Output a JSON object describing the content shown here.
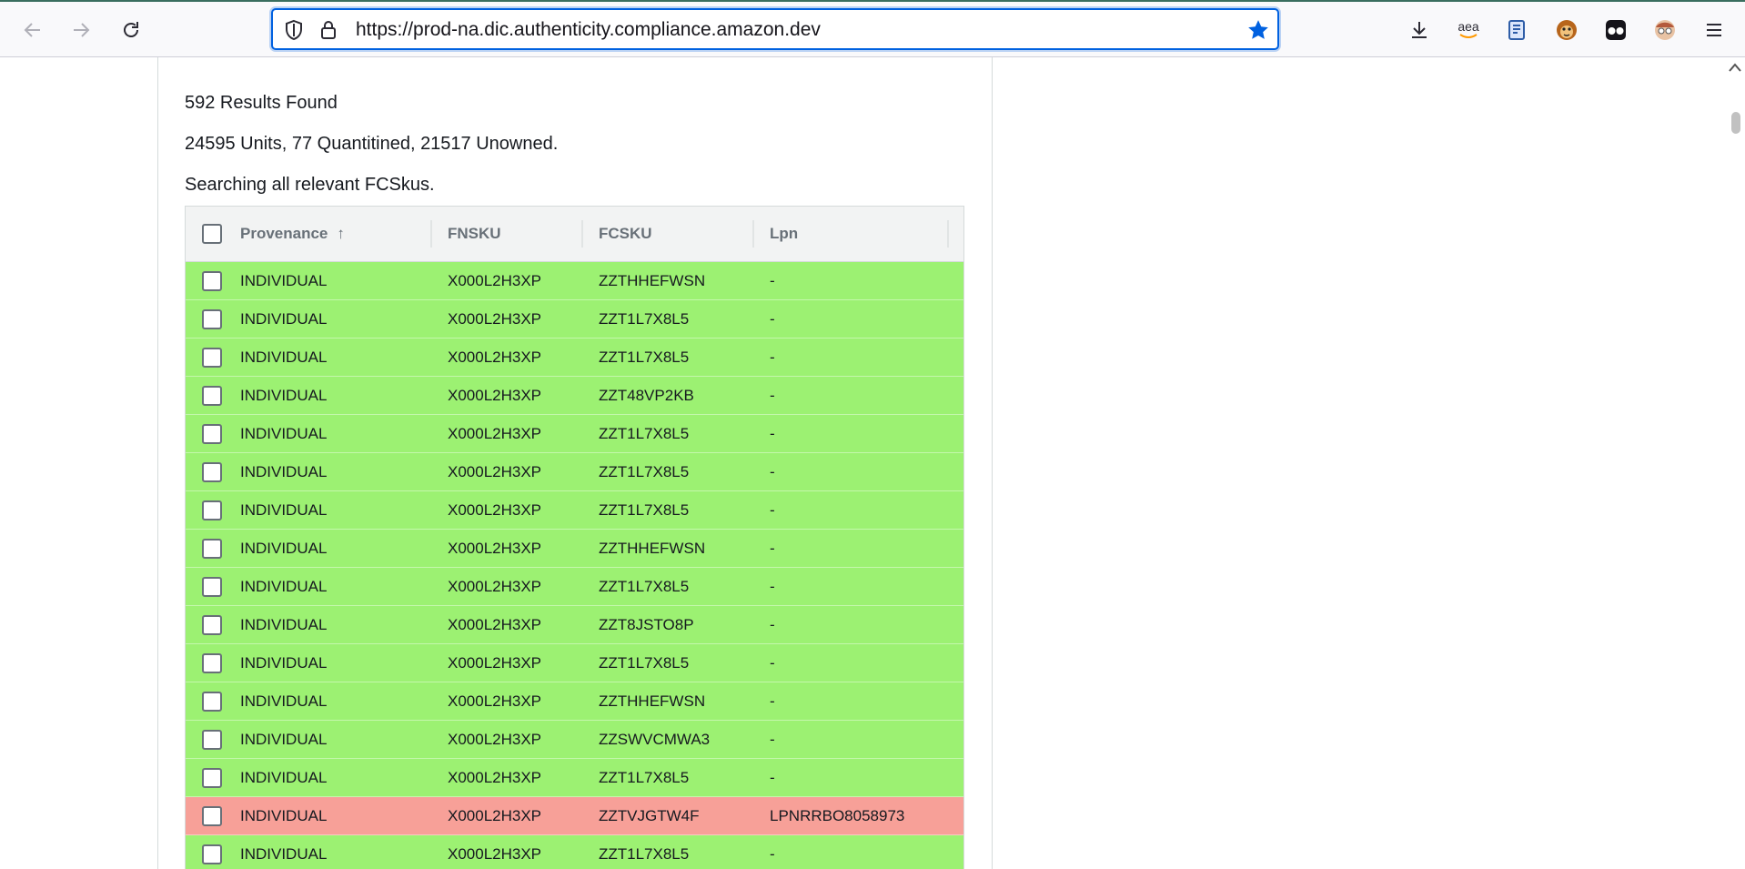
{
  "browser": {
    "url": "https://prod-na.dic.authenticity.compliance.amazon.dev",
    "extensions": [
      "download-icon",
      "amazon-assistant-icon",
      "reader-icon",
      "monkey-extension-icon",
      "glasses-extension-icon",
      "face-extension-icon"
    ],
    "amazon_assistant_label": "aea"
  },
  "summary": {
    "results": "592 Results Found",
    "units": "24595 Units, 77 Quantitined, 21517 Unowned.",
    "scope": "Searching all relevant FCSkus."
  },
  "table": {
    "columns": [
      "Provenance",
      "FNSKU",
      "FCSKU",
      "Lpn"
    ],
    "sort_indicator": "↑",
    "rows": [
      {
        "provenance": "INDIVIDUAL",
        "fnsku": "X000L2H3XP",
        "fcsku": "ZZTHHEFWSN",
        "lpn": "-",
        "status": "ok"
      },
      {
        "provenance": "INDIVIDUAL",
        "fnsku": "X000L2H3XP",
        "fcsku": "ZZT1L7X8L5",
        "lpn": "-",
        "status": "ok"
      },
      {
        "provenance": "INDIVIDUAL",
        "fnsku": "X000L2H3XP",
        "fcsku": "ZZT1L7X8L5",
        "lpn": "-",
        "status": "ok"
      },
      {
        "provenance": "INDIVIDUAL",
        "fnsku": "X000L2H3XP",
        "fcsku": "ZZT48VP2KB",
        "lpn": "-",
        "status": "ok"
      },
      {
        "provenance": "INDIVIDUAL",
        "fnsku": "X000L2H3XP",
        "fcsku": "ZZT1L7X8L5",
        "lpn": "-",
        "status": "ok"
      },
      {
        "provenance": "INDIVIDUAL",
        "fnsku": "X000L2H3XP",
        "fcsku": "ZZT1L7X8L5",
        "lpn": "-",
        "status": "ok"
      },
      {
        "provenance": "INDIVIDUAL",
        "fnsku": "X000L2H3XP",
        "fcsku": "ZZT1L7X8L5",
        "lpn": "-",
        "status": "ok"
      },
      {
        "provenance": "INDIVIDUAL",
        "fnsku": "X000L2H3XP",
        "fcsku": "ZZTHHEFWSN",
        "lpn": "-",
        "status": "ok"
      },
      {
        "provenance": "INDIVIDUAL",
        "fnsku": "X000L2H3XP",
        "fcsku": "ZZT1L7X8L5",
        "lpn": "-",
        "status": "ok"
      },
      {
        "provenance": "INDIVIDUAL",
        "fnsku": "X000L2H3XP",
        "fcsku": "ZZT8JSTO8P",
        "lpn": "-",
        "status": "ok"
      },
      {
        "provenance": "INDIVIDUAL",
        "fnsku": "X000L2H3XP",
        "fcsku": "ZZT1L7X8L5",
        "lpn": "-",
        "status": "ok"
      },
      {
        "provenance": "INDIVIDUAL",
        "fnsku": "X000L2H3XP",
        "fcsku": "ZZTHHEFWSN",
        "lpn": "-",
        "status": "ok"
      },
      {
        "provenance": "INDIVIDUAL",
        "fnsku": "X000L2H3XP",
        "fcsku": "ZZSWVCMWA3",
        "lpn": "-",
        "status": "ok"
      },
      {
        "provenance": "INDIVIDUAL",
        "fnsku": "X000L2H3XP",
        "fcsku": "ZZT1L7X8L5",
        "lpn": "-",
        "status": "ok"
      },
      {
        "provenance": "INDIVIDUAL",
        "fnsku": "X000L2H3XP",
        "fcsku": "ZZTVJGTW4F",
        "lpn": "LPNRRBO8058973",
        "status": "bad"
      },
      {
        "provenance": "INDIVIDUAL",
        "fnsku": "X000L2H3XP",
        "fcsku": "ZZT1L7X8L5",
        "lpn": "-",
        "status": "ok"
      }
    ]
  },
  "colors": {
    "row_ok": "#9cf172",
    "row_bad": "#f7a098",
    "url_focus": "#0061e0"
  }
}
